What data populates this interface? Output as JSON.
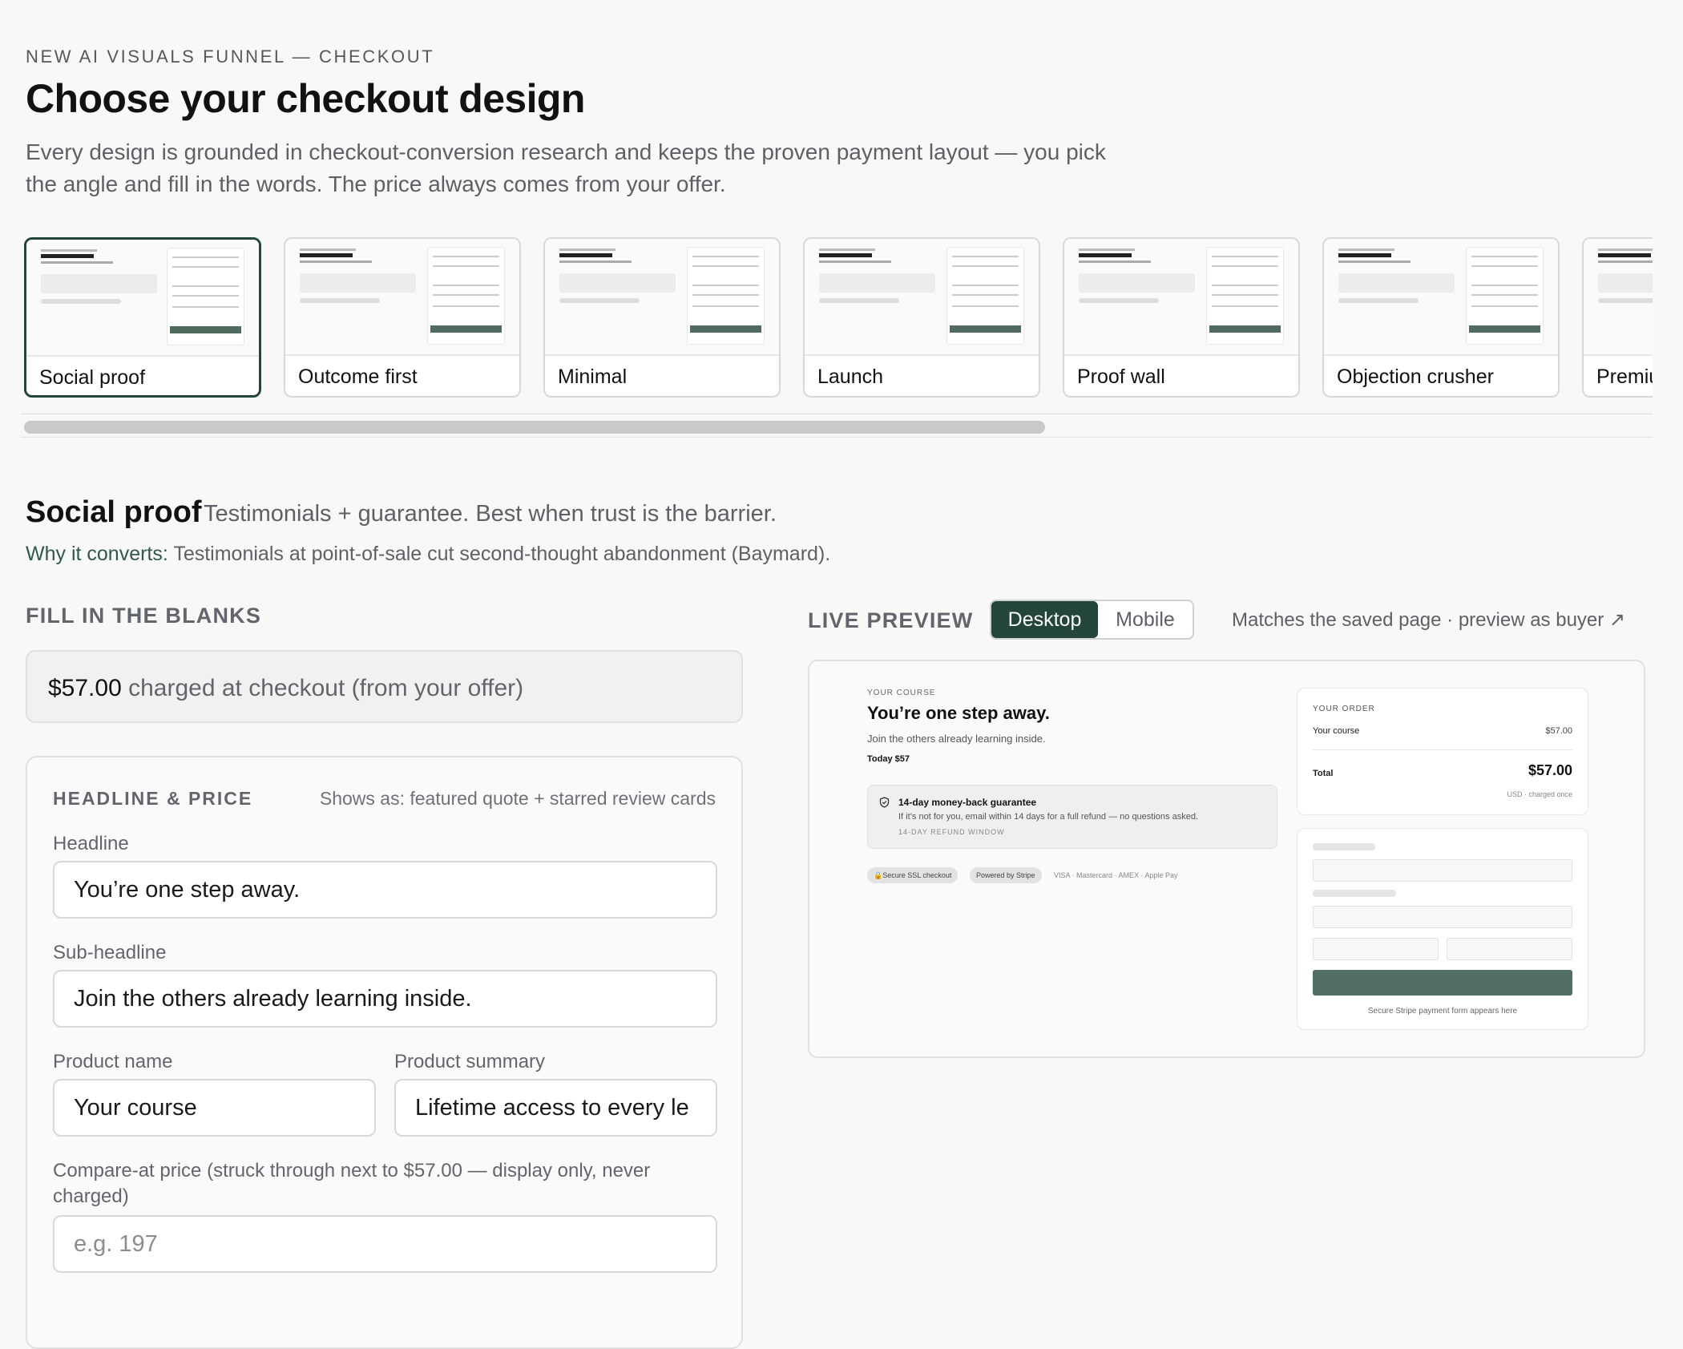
{
  "header": {
    "eyebrow": "NEW AI VISUALS FUNNEL — CHECKOUT",
    "title": "Choose your checkout design",
    "lede": "Every design is grounded in checkout-conversion research and keeps the proven payment layout — you pick the angle and fill in the words. The price always comes from your offer."
  },
  "designs": [
    {
      "label": "Social proof",
      "selected": true
    },
    {
      "label": "Outcome first",
      "selected": false
    },
    {
      "label": "Minimal",
      "selected": false
    },
    {
      "label": "Launch",
      "selected": false
    },
    {
      "label": "Proof wall",
      "selected": false
    },
    {
      "label": "Objection crusher",
      "selected": false
    },
    {
      "label": "Premium",
      "selected": false
    }
  ],
  "section": {
    "title": "Social proof",
    "subtitle": "Testimonials + guarantee. Best when trust is the barrier.",
    "why_label": "Why it converts:",
    "why_text": "Testimonials at point-of-sale cut second-thought abandonment (Baymard)."
  },
  "form": {
    "heading": "FILL IN THE BLANKS",
    "price_value": "$57.00",
    "price_suffix": "charged at checkout (from your offer)",
    "card_heading": "HEADLINE & PRICE",
    "card_note": "Shows as: featured quote + starred review cards",
    "headline_label": "Headline",
    "headline_value": "You’re one step away.",
    "subheadline_label": "Sub-headline",
    "subheadline_value": "Join the others already learning inside.",
    "product_name_label": "Product name",
    "product_name_value": "Your course",
    "product_summary_label": "Product summary",
    "product_summary_value": "Lifetime access to every le",
    "compare_label": "Compare-at price (struck through next to $57.00 — display only, never charged)",
    "compare_placeholder": "e.g. 197"
  },
  "preview": {
    "heading": "LIVE PREVIEW",
    "toggle": {
      "desktop": "Desktop",
      "mobile": "Mobile",
      "active": "Desktop"
    },
    "note": "Matches the saved page · preview as buyer ↗",
    "page": {
      "eyebrow": "YOUR COURSE",
      "headline": "You’re one step away.",
      "subheadline": "Join the others already learning inside.",
      "today": "Today $57",
      "guarantee_title": "14-day money-back guarantee",
      "guarantee_text": "If it’s not for you, email within 14 days for a full refund — no questions asked.",
      "guarantee_window": "14-DAY REFUND WINDOW",
      "chip_ssl": "🔒Secure SSL checkout",
      "chip_stripe": "Powered by Stripe",
      "cards": "VISA · Mastercard · AMEX · Apple Pay",
      "order_heading": "YOUR ORDER",
      "order_item": "Your course",
      "order_item_price": "$57.00",
      "total_label": "Total",
      "total_price": "$57.00",
      "total_note": "USD · charged once",
      "payment_caption": "Secure Stripe payment form appears here"
    }
  },
  "colors": {
    "accent": "#24463a",
    "button": "#536e62"
  },
  "icons": {
    "guarantee": "shield-check-icon"
  }
}
